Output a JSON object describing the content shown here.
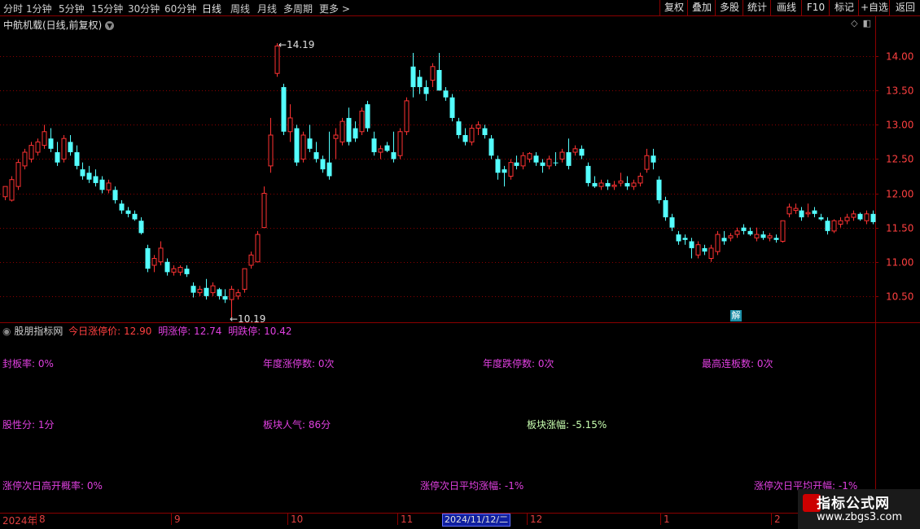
{
  "toolbar": {
    "periods": [
      "分时",
      "1分钟",
      "5分钟",
      "15分钟",
      "30分钟",
      "60分钟",
      "日线",
      "周线",
      "月线",
      "多周期",
      "更多 >"
    ],
    "right_buttons": [
      "复权",
      "叠加",
      "多股",
      "统计",
      "画线",
      "F10",
      "标记",
      "+自选",
      "返回"
    ]
  },
  "chart_title": "中航机载(日线,前复权)",
  "colors": {
    "up": "#ff3232",
    "down": "#54ffff",
    "grid": "#8b0000",
    "axis_label": "#ff4040",
    "magenta": "#e040e0"
  },
  "chart_data": {
    "type": "candlestick",
    "title": "中航机载(日线,前复权)",
    "y_ticks": [
      "14.00",
      "13.50",
      "13.00",
      "12.50",
      "12.00",
      "11.50",
      "11.00",
      "10.50"
    ],
    "ylim": [
      10.13,
      14.37
    ],
    "annotations": {
      "high": "14.19",
      "low": "10.19"
    },
    "x_labels": [
      "2024年",
      "8",
      "9",
      "10",
      "11",
      "12",
      "1",
      "2"
    ],
    "selected_date": "2024/11/12/二",
    "candles": [
      {
        "o": 11.95,
        "h": 12.05,
        "l": 11.9,
        "c": 12.1,
        "u": 1
      },
      {
        "o": 11.9,
        "h": 12.25,
        "l": 11.88,
        "c": 12.2,
        "u": 1
      },
      {
        "o": 12.1,
        "h": 12.5,
        "l": 12.05,
        "c": 12.45,
        "u": 1
      },
      {
        "o": 12.4,
        "h": 12.65,
        "l": 12.35,
        "c": 12.6,
        "u": 1
      },
      {
        "o": 12.5,
        "h": 12.75,
        "l": 12.45,
        "c": 12.7,
        "u": 1
      },
      {
        "o": 12.6,
        "h": 12.8,
        "l": 12.55,
        "c": 12.75,
        "u": 1
      },
      {
        "o": 12.7,
        "h": 13.0,
        "l": 12.65,
        "c": 12.9,
        "u": 1
      },
      {
        "o": 12.8,
        "h": 12.95,
        "l": 12.6,
        "c": 12.65,
        "u": 0
      },
      {
        "o": 12.6,
        "h": 12.75,
        "l": 12.4,
        "c": 12.45,
        "u": 0
      },
      {
        "o": 12.5,
        "h": 12.85,
        "l": 12.45,
        "c": 12.8,
        "u": 1
      },
      {
        "o": 12.75,
        "h": 12.85,
        "l": 12.55,
        "c": 12.6,
        "u": 0
      },
      {
        "o": 12.6,
        "h": 12.7,
        "l": 12.35,
        "c": 12.4,
        "u": 0
      },
      {
        "o": 12.35,
        "h": 12.45,
        "l": 12.2,
        "c": 12.25,
        "u": 0
      },
      {
        "o": 12.3,
        "h": 12.4,
        "l": 12.15,
        "c": 12.2,
        "u": 0
      },
      {
        "o": 12.25,
        "h": 12.35,
        "l": 12.1,
        "c": 12.15,
        "u": 0
      },
      {
        "o": 12.2,
        "h": 12.25,
        "l": 12.0,
        "c": 12.05,
        "u": 0
      },
      {
        "o": 12.05,
        "h": 12.2,
        "l": 12.0,
        "c": 12.15,
        "u": 1
      },
      {
        "o": 12.05,
        "h": 12.1,
        "l": 11.85,
        "c": 11.9,
        "u": 0
      },
      {
        "o": 11.85,
        "h": 11.9,
        "l": 11.7,
        "c": 11.75,
        "u": 0
      },
      {
        "o": 11.75,
        "h": 11.8,
        "l": 11.65,
        "c": 11.7,
        "u": 0
      },
      {
        "o": 11.7,
        "h": 11.75,
        "l": 11.6,
        "c": 11.62,
        "u": 0
      },
      {
        "o": 11.6,
        "h": 11.65,
        "l": 11.4,
        "c": 11.42,
        "u": 0
      },
      {
        "o": 11.2,
        "h": 11.25,
        "l": 10.85,
        "c": 10.9,
        "u": 0
      },
      {
        "o": 10.95,
        "h": 11.1,
        "l": 10.85,
        "c": 11.05,
        "u": 1
      },
      {
        "o": 11.0,
        "h": 11.3,
        "l": 10.95,
        "c": 11.2,
        "u": 1
      },
      {
        "o": 11.0,
        "h": 11.05,
        "l": 10.8,
        "c": 10.85,
        "u": 0
      },
      {
        "o": 10.85,
        "h": 10.95,
        "l": 10.8,
        "c": 10.9,
        "u": 1
      },
      {
        "o": 10.85,
        "h": 10.95,
        "l": 10.8,
        "c": 10.92,
        "u": 1
      },
      {
        "o": 10.9,
        "h": 10.95,
        "l": 10.78,
        "c": 10.82,
        "u": 0
      },
      {
        "o": 10.65,
        "h": 10.7,
        "l": 10.48,
        "c": 10.55,
        "u": 0
      },
      {
        "o": 10.55,
        "h": 10.65,
        "l": 10.5,
        "c": 10.6,
        "u": 1
      },
      {
        "o": 10.62,
        "h": 10.75,
        "l": 10.45,
        "c": 10.5,
        "u": 0
      },
      {
        "o": 10.55,
        "h": 10.7,
        "l": 10.5,
        "c": 10.65,
        "u": 1
      },
      {
        "o": 10.6,
        "h": 10.62,
        "l": 10.45,
        "c": 10.5,
        "u": 0
      },
      {
        "o": 10.5,
        "h": 10.6,
        "l": 10.4,
        "c": 10.45,
        "u": 0
      },
      {
        "o": 10.45,
        "h": 10.65,
        "l": 10.19,
        "c": 10.6,
        "u": 1
      },
      {
        "o": 10.5,
        "h": 10.6,
        "l": 10.45,
        "c": 10.55,
        "u": 1
      },
      {
        "o": 10.6,
        "h": 10.9,
        "l": 10.55,
        "c": 10.9,
        "u": 1
      },
      {
        "o": 10.95,
        "h": 11.15,
        "l": 10.9,
        "c": 11.1,
        "u": 1
      },
      {
        "o": 11.0,
        "h": 11.45,
        "l": 11.0,
        "c": 11.4,
        "u": 1
      },
      {
        "o": 11.5,
        "h": 12.1,
        "l": 11.5,
        "c": 12.0,
        "u": 1
      },
      {
        "o": 12.4,
        "h": 13.1,
        "l": 12.3,
        "c": 12.85,
        "u": 1
      },
      {
        "o": 13.75,
        "h": 14.19,
        "l": 13.7,
        "c": 14.15,
        "u": 1
      },
      {
        "o": 13.55,
        "h": 13.6,
        "l": 12.85,
        "c": 12.9,
        "u": 0
      },
      {
        "o": 12.9,
        "h": 13.3,
        "l": 12.75,
        "c": 13.1,
        "u": 1
      },
      {
        "o": 12.95,
        "h": 13.0,
        "l": 12.4,
        "c": 12.45,
        "u": 0
      },
      {
        "o": 12.5,
        "h": 12.9,
        "l": 12.45,
        "c": 12.85,
        "u": 1
      },
      {
        "o": 12.8,
        "h": 13.0,
        "l": 12.6,
        "c": 12.65,
        "u": 0
      },
      {
        "o": 12.6,
        "h": 12.75,
        "l": 12.45,
        "c": 12.5,
        "u": 0
      },
      {
        "o": 12.5,
        "h": 12.55,
        "l": 12.3,
        "c": 12.35,
        "u": 0
      },
      {
        "o": 12.45,
        "h": 12.9,
        "l": 12.2,
        "c": 12.25,
        "u": 0
      },
      {
        "o": 12.8,
        "h": 12.95,
        "l": 12.5,
        "c": 12.85,
        "u": 1
      },
      {
        "o": 12.75,
        "h": 13.1,
        "l": 12.7,
        "c": 13.05,
        "u": 1
      },
      {
        "o": 13.1,
        "h": 13.25,
        "l": 12.7,
        "c": 12.75,
        "u": 0
      },
      {
        "o": 12.95,
        "h": 13.05,
        "l": 12.75,
        "c": 12.8,
        "u": 0
      },
      {
        "o": 12.9,
        "h": 13.25,
        "l": 12.85,
        "c": 13.2,
        "u": 1
      },
      {
        "o": 13.3,
        "h": 13.35,
        "l": 12.9,
        "c": 12.95,
        "u": 0
      },
      {
        "o": 12.8,
        "h": 12.9,
        "l": 12.55,
        "c": 12.6,
        "u": 0
      },
      {
        "o": 12.6,
        "h": 12.7,
        "l": 12.5,
        "c": 12.65,
        "u": 1
      },
      {
        "o": 12.7,
        "h": 12.75,
        "l": 12.6,
        "c": 12.62,
        "u": 0
      },
      {
        "o": 12.6,
        "h": 12.9,
        "l": 12.45,
        "c": 12.5,
        "u": 0
      },
      {
        "o": 12.55,
        "h": 12.95,
        "l": 12.5,
        "c": 12.9,
        "u": 1
      },
      {
        "o": 12.9,
        "h": 13.4,
        "l": 12.85,
        "c": 13.35,
        "u": 1
      },
      {
        "o": 13.55,
        "h": 14.05,
        "l": 13.4,
        "c": 13.85,
        "u": 0
      },
      {
        "o": 13.7,
        "h": 13.8,
        "l": 13.45,
        "c": 13.55,
        "u": 0
      },
      {
        "o": 13.55,
        "h": 13.65,
        "l": 13.35,
        "c": 13.45,
        "u": 0
      },
      {
        "o": 13.65,
        "h": 13.9,
        "l": 13.55,
        "c": 13.85,
        "u": 1
      },
      {
        "o": 13.8,
        "h": 14.05,
        "l": 13.5,
        "c": 13.5,
        "u": 0
      },
      {
        "o": 13.5,
        "h": 13.55,
        "l": 13.35,
        "c": 13.4,
        "u": 0
      },
      {
        "o": 13.4,
        "h": 13.45,
        "l": 13.05,
        "c": 13.1,
        "u": 0
      },
      {
        "o": 13.05,
        "h": 13.1,
        "l": 12.8,
        "c": 12.85,
        "u": 0
      },
      {
        "o": 12.85,
        "h": 12.95,
        "l": 12.7,
        "c": 12.75,
        "u": 0
      },
      {
        "o": 12.75,
        "h": 13.0,
        "l": 12.7,
        "c": 12.95,
        "u": 1
      },
      {
        "o": 12.95,
        "h": 13.05,
        "l": 12.85,
        "c": 13.0,
        "u": 1
      },
      {
        "o": 12.95,
        "h": 13.0,
        "l": 12.8,
        "c": 12.85,
        "u": 0
      },
      {
        "o": 12.8,
        "h": 12.85,
        "l": 12.5,
        "c": 12.55,
        "u": 0
      },
      {
        "o": 12.5,
        "h": 12.55,
        "l": 12.2,
        "c": 12.3,
        "u": 0
      },
      {
        "o": 12.35,
        "h": 12.4,
        "l": 12.1,
        "c": 12.3,
        "u": 0
      },
      {
        "o": 12.25,
        "h": 12.5,
        "l": 12.2,
        "c": 12.45,
        "u": 1
      },
      {
        "o": 12.45,
        "h": 12.55,
        "l": 12.35,
        "c": 12.4,
        "u": 0
      },
      {
        "o": 12.4,
        "h": 12.6,
        "l": 12.35,
        "c": 12.55,
        "u": 1
      },
      {
        "o": 12.5,
        "h": 12.6,
        "l": 12.45,
        "c": 12.58,
        "u": 1
      },
      {
        "o": 12.55,
        "h": 12.6,
        "l": 12.4,
        "c": 12.45,
        "u": 0
      },
      {
        "o": 12.45,
        "h": 12.5,
        "l": 12.3,
        "c": 12.4,
        "u": 0
      },
      {
        "o": 12.4,
        "h": 12.55,
        "l": 12.35,
        "c": 12.5,
        "u": 1
      },
      {
        "o": 12.45,
        "h": 12.6,
        "l": 12.4,
        "c": 12.45,
        "u": 0
      },
      {
        "o": 12.5,
        "h": 12.65,
        "l": 12.45,
        "c": 12.6,
        "u": 1
      },
      {
        "o": 12.6,
        "h": 12.8,
        "l": 12.35,
        "c": 12.4,
        "u": 0
      },
      {
        "o": 12.6,
        "h": 12.7,
        "l": 12.55,
        "c": 12.65,
        "u": 1
      },
      {
        "o": 12.65,
        "h": 12.7,
        "l": 12.5,
        "c": 12.55,
        "u": 0
      },
      {
        "o": 12.4,
        "h": 12.45,
        "l": 12.1,
        "c": 12.15,
        "u": 0
      },
      {
        "o": 12.15,
        "h": 12.25,
        "l": 12.08,
        "c": 12.1,
        "u": 0
      },
      {
        "o": 12.1,
        "h": 12.2,
        "l": 12.05,
        "c": 12.15,
        "u": 1
      },
      {
        "o": 12.15,
        "h": 12.2,
        "l": 12.05,
        "c": 12.1,
        "u": 0
      },
      {
        "o": 12.1,
        "h": 12.18,
        "l": 12.05,
        "c": 12.12,
        "u": 1
      },
      {
        "o": 12.15,
        "h": 12.3,
        "l": 12.1,
        "c": 12.18,
        "u": 1
      },
      {
        "o": 12.15,
        "h": 12.25,
        "l": 12.05,
        "c": 12.1,
        "u": 0
      },
      {
        "o": 12.1,
        "h": 12.2,
        "l": 12.05,
        "c": 12.15,
        "u": 1
      },
      {
        "o": 12.15,
        "h": 12.3,
        "l": 12.1,
        "c": 12.25,
        "u": 1
      },
      {
        "o": 12.35,
        "h": 12.65,
        "l": 12.3,
        "c": 12.55,
        "u": 1
      },
      {
        "o": 12.55,
        "h": 12.65,
        "l": 12.35,
        "c": 12.45,
        "u": 0
      },
      {
        "o": 12.2,
        "h": 12.25,
        "l": 11.85,
        "c": 11.9,
        "u": 0
      },
      {
        "o": 11.9,
        "h": 11.95,
        "l": 11.6,
        "c": 11.65,
        "u": 0
      },
      {
        "o": 11.65,
        "h": 11.7,
        "l": 11.45,
        "c": 11.5,
        "u": 0
      },
      {
        "o": 11.4,
        "h": 11.45,
        "l": 11.25,
        "c": 11.3,
        "u": 0
      },
      {
        "o": 11.35,
        "h": 11.4,
        "l": 11.25,
        "c": 11.32,
        "u": 0
      },
      {
        "o": 11.3,
        "h": 11.35,
        "l": 11.05,
        "c": 11.2,
        "u": 0
      },
      {
        "o": 11.1,
        "h": 11.3,
        "l": 11.05,
        "c": 11.25,
        "u": 1
      },
      {
        "o": 11.2,
        "h": 11.25,
        "l": 11.1,
        "c": 11.15,
        "u": 0
      },
      {
        "o": 11.05,
        "h": 11.25,
        "l": 11.0,
        "c": 11.2,
        "u": 1
      },
      {
        "o": 11.15,
        "h": 11.45,
        "l": 11.1,
        "c": 11.4,
        "u": 1
      },
      {
        "o": 11.35,
        "h": 11.45,
        "l": 11.25,
        "c": 11.3,
        "u": 0
      },
      {
        "o": 11.35,
        "h": 11.42,
        "l": 11.3,
        "c": 11.38,
        "u": 1
      },
      {
        "o": 11.4,
        "h": 11.5,
        "l": 11.35,
        "c": 11.45,
        "u": 1
      },
      {
        "o": 11.5,
        "h": 11.55,
        "l": 11.4,
        "c": 11.45,
        "u": 0
      },
      {
        "o": 11.45,
        "h": 11.5,
        "l": 11.38,
        "c": 11.4,
        "u": 0
      },
      {
        "o": 11.35,
        "h": 11.5,
        "l": 11.3,
        "c": 11.4,
        "u": 1
      },
      {
        "o": 11.4,
        "h": 11.45,
        "l": 11.32,
        "c": 11.35,
        "u": 0
      },
      {
        "o": 11.35,
        "h": 11.42,
        "l": 11.3,
        "c": 11.38,
        "u": 1
      },
      {
        "o": 11.35,
        "h": 11.4,
        "l": 11.28,
        "c": 11.32,
        "u": 0
      },
      {
        "o": 11.3,
        "h": 11.6,
        "l": 11.28,
        "c": 11.6,
        "u": 1
      },
      {
        "o": 11.7,
        "h": 11.85,
        "l": 11.65,
        "c": 11.8,
        "u": 1
      },
      {
        "o": 11.75,
        "h": 11.85,
        "l": 11.7,
        "c": 11.78,
        "u": 1
      },
      {
        "o": 11.75,
        "h": 11.8,
        "l": 11.6,
        "c": 11.65,
        "u": 0
      },
      {
        "o": 11.7,
        "h": 11.85,
        "l": 11.65,
        "c": 11.72,
        "u": 1
      },
      {
        "o": 11.75,
        "h": 11.8,
        "l": 11.65,
        "c": 11.7,
        "u": 0
      },
      {
        "o": 11.65,
        "h": 11.7,
        "l": 11.6,
        "c": 11.62,
        "u": 0
      },
      {
        "o": 11.6,
        "h": 11.65,
        "l": 11.4,
        "c": 11.45,
        "u": 0
      },
      {
        "o": 11.45,
        "h": 11.62,
        "l": 11.42,
        "c": 11.6,
        "u": 1
      },
      {
        "o": 11.55,
        "h": 11.65,
        "l": 11.5,
        "c": 11.6,
        "u": 1
      },
      {
        "o": 11.6,
        "h": 11.7,
        "l": 11.55,
        "c": 11.65,
        "u": 1
      },
      {
        "o": 11.65,
        "h": 11.75,
        "l": 11.6,
        "c": 11.7,
        "u": 1
      },
      {
        "o": 11.7,
        "h": 11.72,
        "l": 11.6,
        "c": 11.62,
        "u": 0
      },
      {
        "o": 11.6,
        "h": 11.75,
        "l": 11.55,
        "c": 11.7,
        "u": 1
      },
      {
        "o": 11.7,
        "h": 11.75,
        "l": 11.55,
        "c": 11.58,
        "u": 0
      }
    ]
  },
  "indicator": {
    "name": "股朋指标网",
    "limit_up_today": "今日涨停价: 12.90",
    "limit_up_tomorrow": "明涨停: 12.74",
    "limit_down_tomorrow": "明跌停: 10.42",
    "jie": "解",
    "items": [
      "封板率: 0%",
      "年度涨停数: 0次",
      "年度跌停数: 0次",
      "最高连板数: 0次",
      "股性分: 1分",
      "板块人气: 86分",
      "板块涨幅: -5.15%",
      "涨停次日高开概率: 0%",
      "涨停次日平均涨幅: -1%",
      "涨停次日平均开幅: -1%"
    ]
  },
  "watermark": {
    "title": "指标公式网",
    "url": "www.zbgs3.com"
  }
}
